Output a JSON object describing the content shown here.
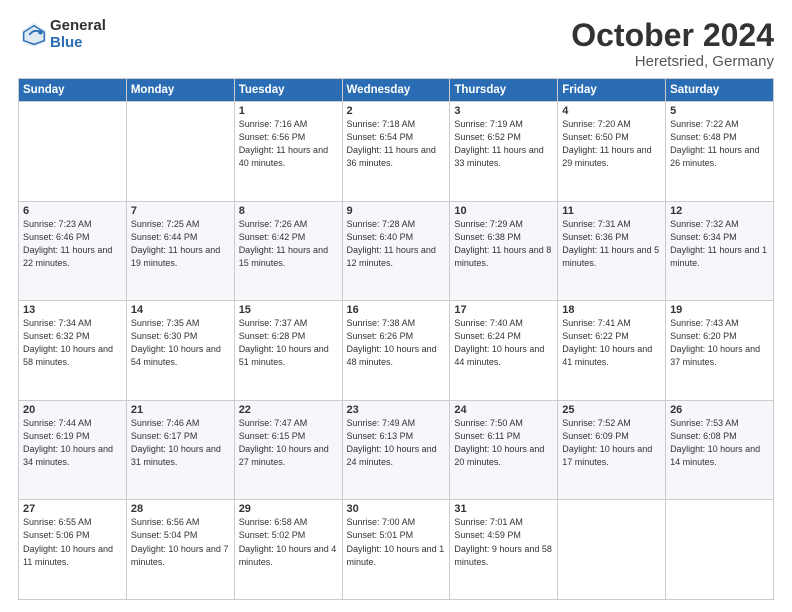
{
  "logo": {
    "general": "General",
    "blue": "Blue"
  },
  "title": {
    "month_year": "October 2024",
    "location": "Heretsried, Germany"
  },
  "headers": [
    "Sunday",
    "Monday",
    "Tuesday",
    "Wednesday",
    "Thursday",
    "Friday",
    "Saturday"
  ],
  "weeks": [
    [
      {
        "day": "",
        "sunrise": "",
        "sunset": "",
        "daylight": ""
      },
      {
        "day": "",
        "sunrise": "",
        "sunset": "",
        "daylight": ""
      },
      {
        "day": "1",
        "sunrise": "Sunrise: 7:16 AM",
        "sunset": "Sunset: 6:56 PM",
        "daylight": "Daylight: 11 hours and 40 minutes."
      },
      {
        "day": "2",
        "sunrise": "Sunrise: 7:18 AM",
        "sunset": "Sunset: 6:54 PM",
        "daylight": "Daylight: 11 hours and 36 minutes."
      },
      {
        "day": "3",
        "sunrise": "Sunrise: 7:19 AM",
        "sunset": "Sunset: 6:52 PM",
        "daylight": "Daylight: 11 hours and 33 minutes."
      },
      {
        "day": "4",
        "sunrise": "Sunrise: 7:20 AM",
        "sunset": "Sunset: 6:50 PM",
        "daylight": "Daylight: 11 hours and 29 minutes."
      },
      {
        "day": "5",
        "sunrise": "Sunrise: 7:22 AM",
        "sunset": "Sunset: 6:48 PM",
        "daylight": "Daylight: 11 hours and 26 minutes."
      }
    ],
    [
      {
        "day": "6",
        "sunrise": "Sunrise: 7:23 AM",
        "sunset": "Sunset: 6:46 PM",
        "daylight": "Daylight: 11 hours and 22 minutes."
      },
      {
        "day": "7",
        "sunrise": "Sunrise: 7:25 AM",
        "sunset": "Sunset: 6:44 PM",
        "daylight": "Daylight: 11 hours and 19 minutes."
      },
      {
        "day": "8",
        "sunrise": "Sunrise: 7:26 AM",
        "sunset": "Sunset: 6:42 PM",
        "daylight": "Daylight: 11 hours and 15 minutes."
      },
      {
        "day": "9",
        "sunrise": "Sunrise: 7:28 AM",
        "sunset": "Sunset: 6:40 PM",
        "daylight": "Daylight: 11 hours and 12 minutes."
      },
      {
        "day": "10",
        "sunrise": "Sunrise: 7:29 AM",
        "sunset": "Sunset: 6:38 PM",
        "daylight": "Daylight: 11 hours and 8 minutes."
      },
      {
        "day": "11",
        "sunrise": "Sunrise: 7:31 AM",
        "sunset": "Sunset: 6:36 PM",
        "daylight": "Daylight: 11 hours and 5 minutes."
      },
      {
        "day": "12",
        "sunrise": "Sunrise: 7:32 AM",
        "sunset": "Sunset: 6:34 PM",
        "daylight": "Daylight: 11 hours and 1 minute."
      }
    ],
    [
      {
        "day": "13",
        "sunrise": "Sunrise: 7:34 AM",
        "sunset": "Sunset: 6:32 PM",
        "daylight": "Daylight: 10 hours and 58 minutes."
      },
      {
        "day": "14",
        "sunrise": "Sunrise: 7:35 AM",
        "sunset": "Sunset: 6:30 PM",
        "daylight": "Daylight: 10 hours and 54 minutes."
      },
      {
        "day": "15",
        "sunrise": "Sunrise: 7:37 AM",
        "sunset": "Sunset: 6:28 PM",
        "daylight": "Daylight: 10 hours and 51 minutes."
      },
      {
        "day": "16",
        "sunrise": "Sunrise: 7:38 AM",
        "sunset": "Sunset: 6:26 PM",
        "daylight": "Daylight: 10 hours and 48 minutes."
      },
      {
        "day": "17",
        "sunrise": "Sunrise: 7:40 AM",
        "sunset": "Sunset: 6:24 PM",
        "daylight": "Daylight: 10 hours and 44 minutes."
      },
      {
        "day": "18",
        "sunrise": "Sunrise: 7:41 AM",
        "sunset": "Sunset: 6:22 PM",
        "daylight": "Daylight: 10 hours and 41 minutes."
      },
      {
        "day": "19",
        "sunrise": "Sunrise: 7:43 AM",
        "sunset": "Sunset: 6:20 PM",
        "daylight": "Daylight: 10 hours and 37 minutes."
      }
    ],
    [
      {
        "day": "20",
        "sunrise": "Sunrise: 7:44 AM",
        "sunset": "Sunset: 6:19 PM",
        "daylight": "Daylight: 10 hours and 34 minutes."
      },
      {
        "day": "21",
        "sunrise": "Sunrise: 7:46 AM",
        "sunset": "Sunset: 6:17 PM",
        "daylight": "Daylight: 10 hours and 31 minutes."
      },
      {
        "day": "22",
        "sunrise": "Sunrise: 7:47 AM",
        "sunset": "Sunset: 6:15 PM",
        "daylight": "Daylight: 10 hours and 27 minutes."
      },
      {
        "day": "23",
        "sunrise": "Sunrise: 7:49 AM",
        "sunset": "Sunset: 6:13 PM",
        "daylight": "Daylight: 10 hours and 24 minutes."
      },
      {
        "day": "24",
        "sunrise": "Sunrise: 7:50 AM",
        "sunset": "Sunset: 6:11 PM",
        "daylight": "Daylight: 10 hours and 20 minutes."
      },
      {
        "day": "25",
        "sunrise": "Sunrise: 7:52 AM",
        "sunset": "Sunset: 6:09 PM",
        "daylight": "Daylight: 10 hours and 17 minutes."
      },
      {
        "day": "26",
        "sunrise": "Sunrise: 7:53 AM",
        "sunset": "Sunset: 6:08 PM",
        "daylight": "Daylight: 10 hours and 14 minutes."
      }
    ],
    [
      {
        "day": "27",
        "sunrise": "Sunrise: 6:55 AM",
        "sunset": "Sunset: 5:06 PM",
        "daylight": "Daylight: 10 hours and 11 minutes."
      },
      {
        "day": "28",
        "sunrise": "Sunrise: 6:56 AM",
        "sunset": "Sunset: 5:04 PM",
        "daylight": "Daylight: 10 hours and 7 minutes."
      },
      {
        "day": "29",
        "sunrise": "Sunrise: 6:58 AM",
        "sunset": "Sunset: 5:02 PM",
        "daylight": "Daylight: 10 hours and 4 minutes."
      },
      {
        "day": "30",
        "sunrise": "Sunrise: 7:00 AM",
        "sunset": "Sunset: 5:01 PM",
        "daylight": "Daylight: 10 hours and 1 minute."
      },
      {
        "day": "31",
        "sunrise": "Sunrise: 7:01 AM",
        "sunset": "Sunset: 4:59 PM",
        "daylight": "Daylight: 9 hours and 58 minutes."
      },
      {
        "day": "",
        "sunrise": "",
        "sunset": "",
        "daylight": ""
      },
      {
        "day": "",
        "sunrise": "",
        "sunset": "",
        "daylight": ""
      }
    ]
  ]
}
